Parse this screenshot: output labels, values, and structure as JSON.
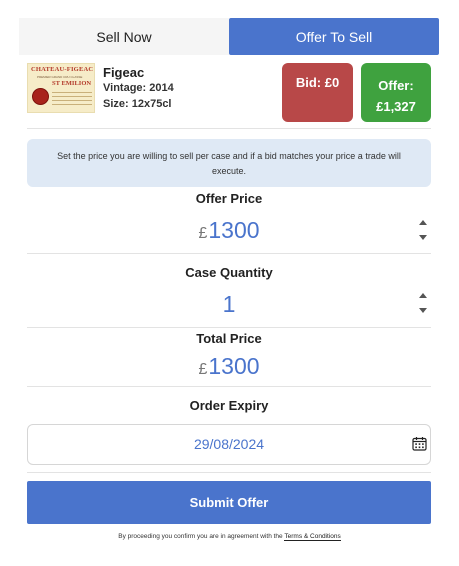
{
  "tabs": {
    "sell_now": "Sell Now",
    "offer_to_sell": "Offer To Sell",
    "active": "offer_to_sell"
  },
  "wine": {
    "image": {
      "label_top": "CHATEAU-FIGEAC",
      "label_middle": "PREMIER GRAND CRU CLASSE",
      "label_st": "ST EMILION"
    },
    "name": "Figeac",
    "vintage": "Vintage: 2014",
    "size": "Size: 12x75cl"
  },
  "bid": {
    "label": "Bid: £0",
    "color": "#b84848"
  },
  "offer": {
    "label": "Offer:",
    "value": "£1,327",
    "color": "#3fa23f"
  },
  "info_text": "Set the price you are willing to sell per case and if a bid matches your price a trade will execute.",
  "offer_price": {
    "label": "Offer Price",
    "currency": "£",
    "value": "1300"
  },
  "case_quantity": {
    "label": "Case Quantity",
    "value": "1"
  },
  "total_price": {
    "label": "Total Price",
    "currency": "£",
    "value": "1300"
  },
  "order_expiry": {
    "label": "Order Expiry",
    "value": "29/08/2024",
    "icon": "calendar-icon"
  },
  "submit_label": "Submit Offer",
  "terms": {
    "prefix": "By proceeding you confirm you are in agreement with the",
    "link": "Terms & Conditions"
  },
  "colors": {
    "accent": "#4a74cc",
    "info_bg": "#dfe9f5"
  }
}
